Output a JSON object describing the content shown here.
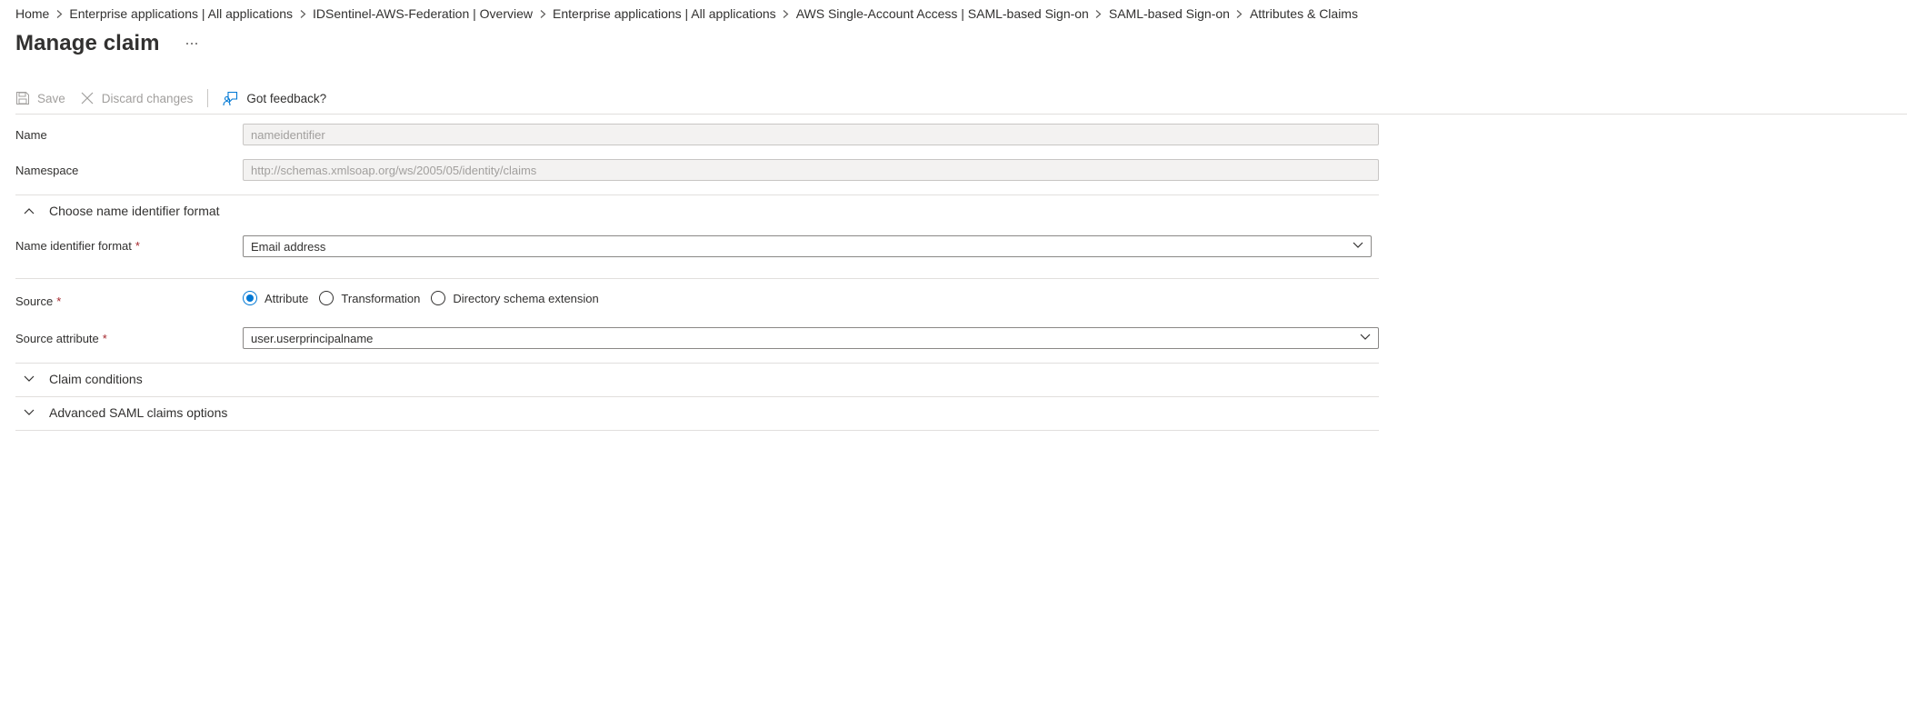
{
  "breadcrumb": [
    {
      "label": "Home"
    },
    {
      "label": "Enterprise applications | All applications"
    },
    {
      "label": "IDSentinel-AWS-Federation | Overview"
    },
    {
      "label": "Enterprise applications | All applications"
    },
    {
      "label": "AWS Single-Account Access | SAML-based Sign-on"
    },
    {
      "label": "SAML-based Sign-on"
    },
    {
      "label": "Attributes & Claims"
    }
  ],
  "page": {
    "title": "Manage claim",
    "more_icon": "ellipsis-icon"
  },
  "toolbar": {
    "save_label": "Save",
    "discard_label": "Discard changes",
    "feedback_label": "Got feedback?"
  },
  "form": {
    "name_label": "Name",
    "name_value": "nameidentifier",
    "namespace_label": "Namespace",
    "namespace_value": "http://schemas.xmlsoap.org/ws/2005/05/identity/claims",
    "format_section_label": "Choose name identifier format",
    "format_label": "Name identifier format",
    "format_value": "Email address",
    "source_label": "Source",
    "source_options": [
      {
        "label": "Attribute",
        "checked": true
      },
      {
        "label": "Transformation",
        "checked": false
      },
      {
        "label": "Directory schema extension",
        "checked": false
      }
    ],
    "source_attribute_label": "Source attribute",
    "source_attribute_value": "user.userprincipalname",
    "required_mark": "*"
  },
  "sections": {
    "claim_conditions": "Claim conditions",
    "advanced": "Advanced SAML claims options"
  },
  "colors": {
    "accent": "#0078d4",
    "required": "#a4262c",
    "disabled_text": "#a19f9d"
  }
}
